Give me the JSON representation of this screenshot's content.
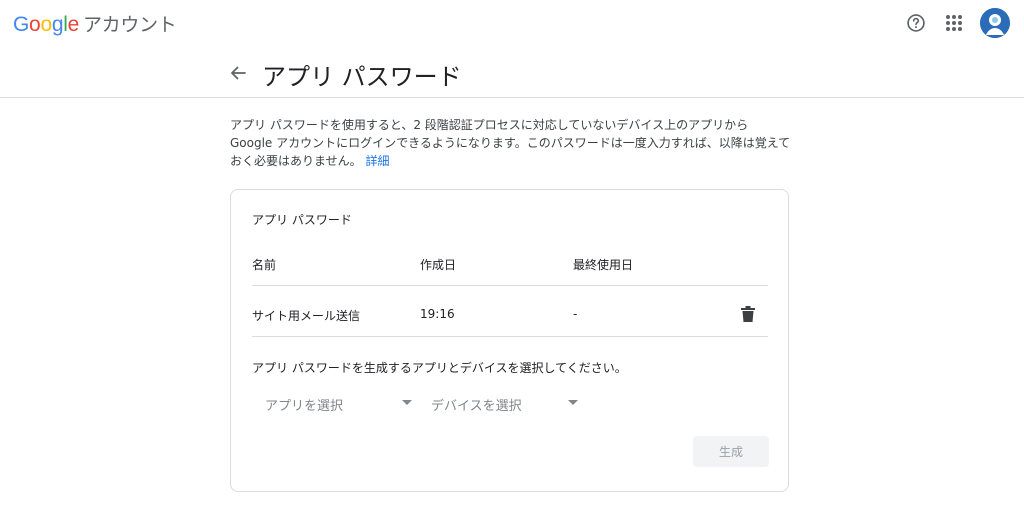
{
  "header": {
    "logo": {
      "letters": [
        "G",
        "o",
        "o",
        "g",
        "l",
        "e"
      ],
      "product": "アカウント"
    },
    "help_icon": "help-circle-icon",
    "apps_icon": "apps-grid-icon",
    "avatar_icon": "user-avatar"
  },
  "page": {
    "back_icon": "arrow-back-icon",
    "title": "アプリ パスワード"
  },
  "description": {
    "line1": "アプリ パスワードを使用すると、2 段階認証プロセスに対応していないデバイス上のアプリから",
    "line2": "Google アカウントにログインできるようになります。このパスワードは一度入力すれば、以降は覚えて",
    "line3": "おく必要はありません。",
    "link": "詳細"
  },
  "card": {
    "title": "アプリ パスワード",
    "columns": {
      "name": "名前",
      "created": "作成日",
      "last_used": "最終使用日"
    },
    "rows": [
      {
        "name": "サイト用メール送信",
        "created": "19:16",
        "last_used": "-",
        "delete_icon": "trash-icon"
      }
    ],
    "instruction": "アプリ パスワードを生成するアプリとデバイスを選択してください。",
    "app_select": "アプリを選択",
    "device_select": "デバイスを選択",
    "generate_button": "生成"
  },
  "colors": {
    "accent": "#1a73e8",
    "divider": "#dadce0",
    "disabled_bg": "#f1f3f4",
    "disabled_text": "#9aa0a6"
  }
}
